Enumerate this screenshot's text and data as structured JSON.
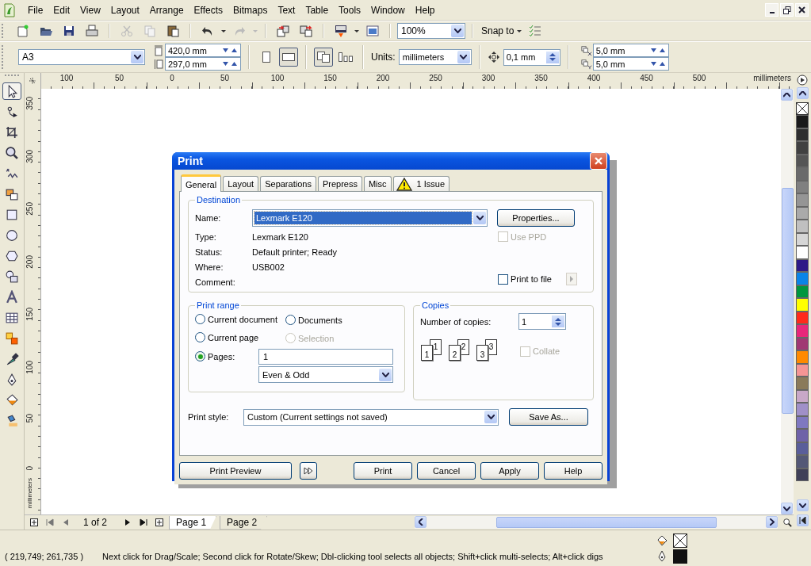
{
  "menu": [
    "File",
    "Edit",
    "View",
    "Layout",
    "Arrange",
    "Effects",
    "Bitmaps",
    "Text",
    "Table",
    "Tools",
    "Window",
    "Help"
  ],
  "toolbar": {
    "zoom": "100%",
    "snap": "Snap to"
  },
  "property_bar": {
    "paper": "A3",
    "width": "420,0 mm",
    "height": "297,0 mm",
    "orientation": [
      {
        "kind": "portrait",
        "selected": false
      },
      {
        "kind": "landscape",
        "selected": true
      }
    ],
    "page_layout": [
      {
        "kind": "all-pages",
        "selected": true
      },
      {
        "kind": "current-page",
        "selected": false
      }
    ],
    "units_label": "Units:",
    "units": "millimeters",
    "nudge": "0,1 mm",
    "duplicate_x": "5,0 mm",
    "duplicate_y": "5,0 mm"
  },
  "horizontal_ruler": {
    "labels": [
      "100",
      "50",
      "0",
      "50",
      "100",
      "150",
      "200",
      "250",
      "300",
      "350",
      "400",
      "450",
      "500"
    ],
    "unit": "millimeters"
  },
  "vertical_ruler": {
    "labels": [
      "350",
      "300",
      "250",
      "200",
      "150",
      "100",
      "50",
      "0"
    ],
    "unit": "millimeters"
  },
  "toolbox": [
    {
      "kind": "pick",
      "selected": true
    },
    {
      "kind": "shape",
      "selected": false
    },
    {
      "kind": "crop",
      "selected": false
    },
    {
      "kind": "zoom",
      "selected": false
    },
    {
      "kind": "freehand",
      "selected": false
    },
    {
      "kind": "smart-fill",
      "selected": false
    },
    {
      "kind": "rectangle",
      "selected": false
    },
    {
      "kind": "ellipse",
      "selected": false
    },
    {
      "kind": "polygon",
      "selected": false
    },
    {
      "kind": "basic-shapes",
      "selected": false
    },
    {
      "kind": "text",
      "selected": false
    },
    {
      "kind": "table",
      "selected": false
    },
    {
      "kind": "blend",
      "selected": false
    },
    {
      "kind": "eyedropper",
      "selected": false
    },
    {
      "kind": "outline",
      "selected": false
    },
    {
      "kind": "fill",
      "selected": false
    },
    {
      "kind": "interactive-fill",
      "selected": false
    }
  ],
  "palette": [
    {
      "color": "#1a1a1a"
    },
    {
      "color": "#2e2e2e"
    },
    {
      "color": "#414141"
    },
    {
      "color": "#555555"
    },
    {
      "color": "#6a6a6a"
    },
    {
      "color": "#808080"
    },
    {
      "color": "#959595"
    },
    {
      "color": "#aaaaaa"
    },
    {
      "color": "#c0c0c0"
    },
    {
      "color": "#d6d6d6"
    },
    {
      "color": "#ffffff"
    },
    {
      "color": "#2e1a87"
    },
    {
      "color": "#0a84e8"
    },
    {
      "color": "#00963e"
    },
    {
      "color": "#ffff00"
    },
    {
      "color": "#ff2a1a"
    },
    {
      "color": "#e8277a"
    },
    {
      "color": "#a03873"
    },
    {
      "color": "#ff8a00"
    },
    {
      "color": "#f59595"
    },
    {
      "color": "#8a7a5a"
    },
    {
      "color": "#c8a8c8"
    },
    {
      "color": "#a090c8"
    },
    {
      "color": "#7f78c0"
    },
    {
      "color": "#6f62a8"
    },
    {
      "color": "#5a5e9a"
    },
    {
      "color": "#545876"
    },
    {
      "color": "#404058"
    }
  ],
  "print_dialog": {
    "title": "Print",
    "tabs": [
      {
        "label": "General",
        "selected": true,
        "warning": false
      },
      {
        "label": "Layout",
        "selected": false,
        "warning": false
      },
      {
        "label": "Separations",
        "selected": false,
        "warning": false
      },
      {
        "label": "Prepress",
        "selected": false,
        "warning": false
      },
      {
        "label": "Misc",
        "selected": false,
        "warning": false
      },
      {
        "label": "1 Issue",
        "selected": false,
        "warning": true
      }
    ],
    "destination": {
      "legend": "Destination",
      "name_label": "Name:",
      "name": "Lexmark E120",
      "properties_button": "Properties...",
      "info": [
        {
          "label": "Type:",
          "value": "Lexmark E120"
        },
        {
          "label": "Status:",
          "value": "Default printer; Ready"
        },
        {
          "label": "Where:",
          "value": "USB002"
        },
        {
          "label": "Comment:"
        }
      ],
      "use_ppd": {
        "label": "Use PPD",
        "checked": false,
        "disabled": true
      },
      "print_to_file": {
        "label": "Print to file",
        "checked": false
      }
    },
    "print_range": {
      "legend": "Print range",
      "options": [
        {
          "label": "Current document",
          "selected": false,
          "disabled": false
        },
        {
          "label": "Documents",
          "selected": false,
          "disabled": false
        },
        {
          "label": "Current page",
          "selected": false,
          "disabled": false
        },
        {
          "label": "Selection",
          "selected": false,
          "disabled": true
        },
        {
          "label": "Pages:",
          "selected": true,
          "disabled": false
        }
      ],
      "pages": "1",
      "subset": "Even & Odd"
    },
    "copies": {
      "legend": "Copies",
      "label": "Number of copies:",
      "value": "1",
      "stacks": [
        {
          "back": "1",
          "front": "1"
        },
        {
          "back": "2",
          "front": "2"
        },
        {
          "back": "3",
          "front": "3"
        }
      ],
      "collate": {
        "label": "Collate",
        "checked": false,
        "disabled": true
      }
    },
    "print_style": {
      "label": "Print style:",
      "value": "Custom (Current settings not saved)",
      "button": "Save As..."
    },
    "buttons": {
      "preview": "Print Preview",
      "actions": [
        "Print",
        "Cancel",
        "Apply",
        "Help"
      ]
    }
  },
  "page_navigator": {
    "counter": "1 of 2",
    "pages": [
      {
        "label": "Page 1",
        "selected": true
      },
      {
        "label": "Page 2",
        "selected": false
      }
    ]
  },
  "status_bar": {
    "coordinates": "( 219,749; 261,735 )",
    "message": "Next click for Drag/Scale; Second click for Rotate/Skew; Dbl-clicking tool selects all objects; Shift+click multi-selects; Alt+click digs"
  }
}
